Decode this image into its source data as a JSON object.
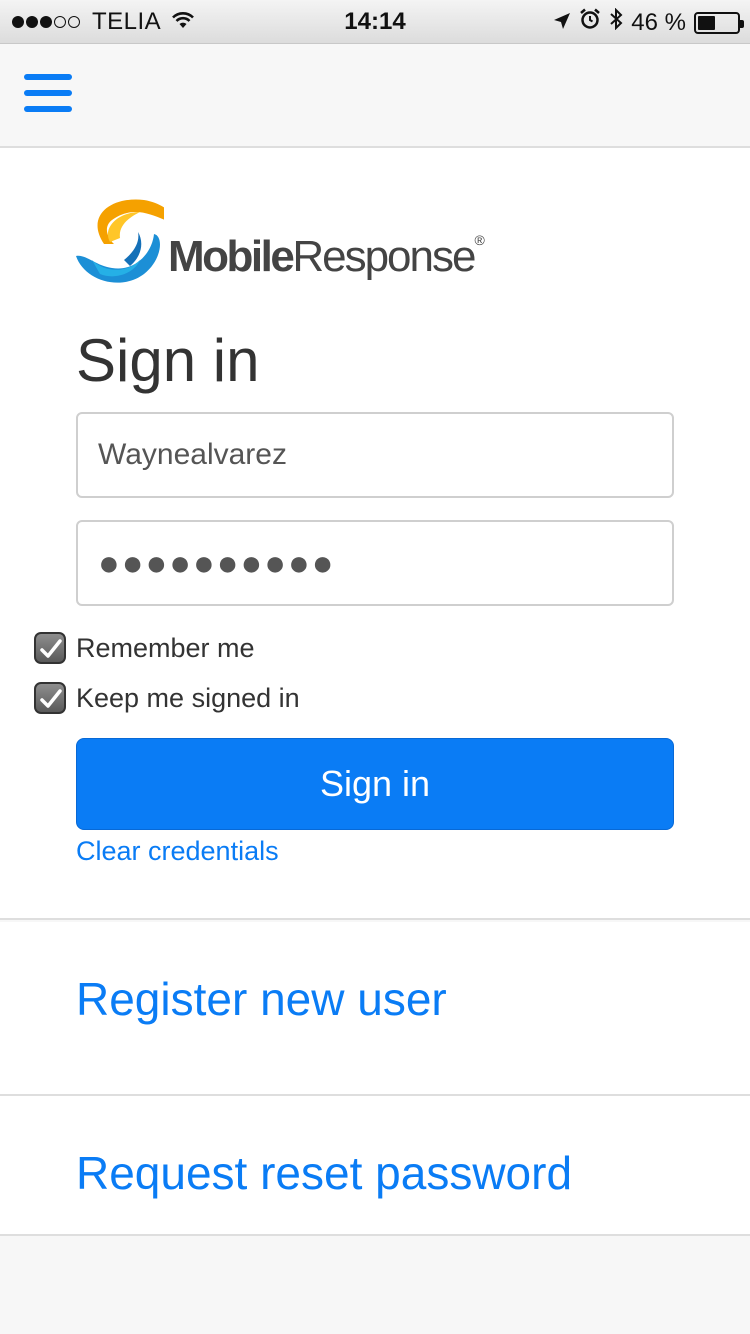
{
  "status_bar": {
    "carrier": "TELIA",
    "time": "14:14",
    "battery_text": "46 %",
    "battery_level": 0.46,
    "signal_bars_filled": 3,
    "signal_bars_total": 5
  },
  "nav": {
    "menu_icon": "hamburger-menu-icon"
  },
  "logo": {
    "bold": "Mobile",
    "rest": "Response",
    "registered": "®"
  },
  "signin": {
    "title": "Sign in",
    "username_value": "Waynealvarez",
    "password_value": "●●●●●●●●●●",
    "remember_label": "Remember me",
    "remember_checked": true,
    "keep_signed_label": "Keep me signed in",
    "keep_signed_checked": true,
    "button_label": "Sign in",
    "clear_link": "Clear credentials"
  },
  "links": {
    "register": "Register new user",
    "reset": "Request reset password"
  },
  "colors": {
    "accent": "#0a7cf5",
    "logo_orange": "#f5a100",
    "logo_blue": "#1c8fd6"
  }
}
